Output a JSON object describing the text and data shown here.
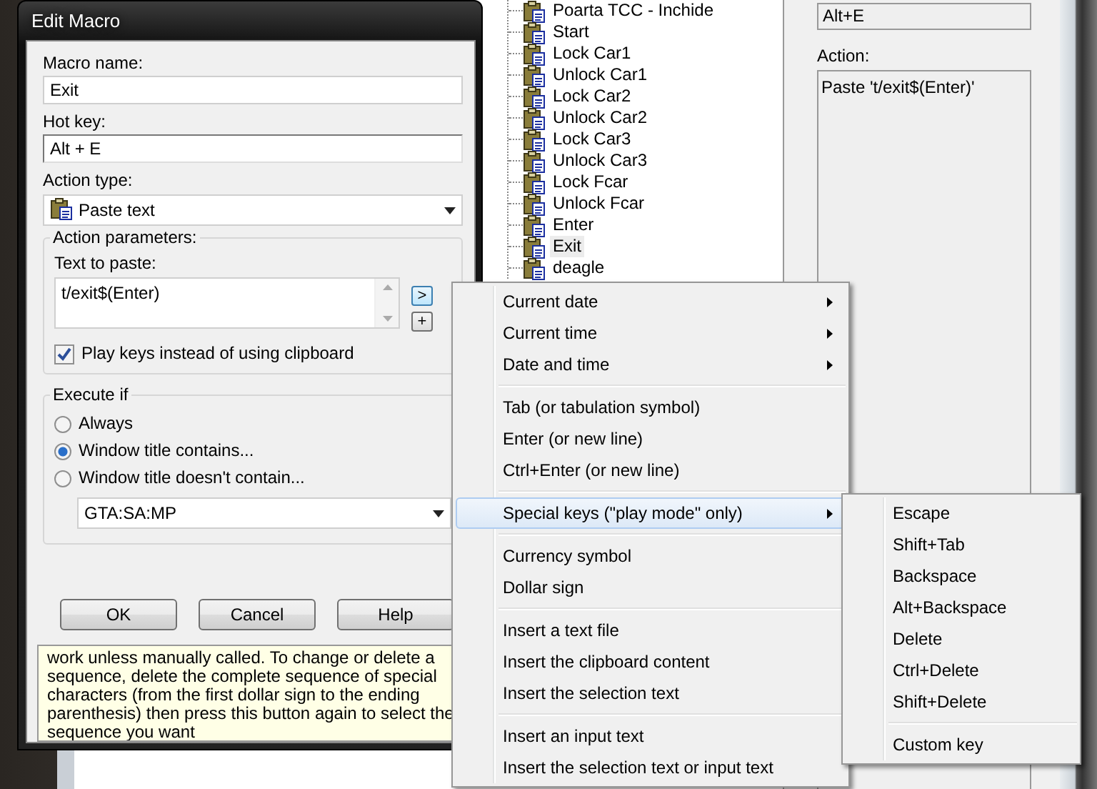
{
  "background_window": {
    "tree_items": [
      {
        "label": "Poarta TCC - Inchide",
        "selected": false
      },
      {
        "label": "Start",
        "selected": false
      },
      {
        "label": "Lock Car1",
        "selected": false
      },
      {
        "label": "Unlock Car1",
        "selected": false
      },
      {
        "label": "Lock Car2",
        "selected": false
      },
      {
        "label": "Unlock Car2",
        "selected": false
      },
      {
        "label": "Lock Car3",
        "selected": false
      },
      {
        "label": "Unlock Car3",
        "selected": false
      },
      {
        "label": "Lock Fcar",
        "selected": false
      },
      {
        "label": "Unlock Fcar",
        "selected": false
      },
      {
        "label": "Enter",
        "selected": false
      },
      {
        "label": "Exit",
        "selected": true
      },
      {
        "label": "deagle",
        "selected": false
      }
    ],
    "hotkey_value": "Alt+E",
    "action_label": "Action:",
    "action_value": "Paste 't/exit$(Enter)'"
  },
  "dialog": {
    "title": "Edit Macro",
    "macro_name_label": "Macro name:",
    "macro_name_value": "Exit",
    "hotkey_label": "Hot key:",
    "hotkey_value": "Alt + E",
    "action_type_label": "Action type:",
    "action_type_value": "Paste text",
    "parameters_group": "Action parameters:",
    "text_to_paste_label": "Text to paste:",
    "text_to_paste_value": "t/exit$(Enter)",
    "insert_button": ">",
    "add_button": "+",
    "play_keys": {
      "label": "Play keys instead of using clipboard",
      "checked": true
    },
    "execute_group": "Execute if",
    "conditions": [
      {
        "label": "Always",
        "selected": false
      },
      {
        "label": "Window title contains...",
        "selected": true
      },
      {
        "label": "Window title doesn't contain...",
        "selected": false
      }
    ],
    "window_title_value": "GTA:SA:MP",
    "buttons": [
      "OK",
      "Cancel",
      "Help"
    ],
    "help_text": "work unless manually called. To change or delete a sequence, delete the complete sequence of special characters (from the first dollar sign to the ending parenthesis) then press this button again to select the sequence you want"
  },
  "context_menu": {
    "groups": [
      [
        {
          "label": "Current date",
          "submenu": true,
          "highlighted": false
        },
        {
          "label": "Current time",
          "submenu": true,
          "highlighted": false
        },
        {
          "label": "Date and time",
          "submenu": true,
          "highlighted": false
        }
      ],
      [
        {
          "label": "Tab (or tabulation symbol)",
          "submenu": false,
          "highlighted": false
        },
        {
          "label": "Enter (or new line)",
          "submenu": false,
          "highlighted": false
        },
        {
          "label": "Ctrl+Enter (or new line)",
          "submenu": false,
          "highlighted": false
        }
      ],
      [
        {
          "label": "Special keys (\"play mode\" only)",
          "submenu": true,
          "highlighted": true
        }
      ],
      [
        {
          "label": "Currency symbol",
          "submenu": false,
          "highlighted": false
        },
        {
          "label": "Dollar sign",
          "submenu": false,
          "highlighted": false
        }
      ],
      [
        {
          "label": "Insert a text file",
          "submenu": false,
          "highlighted": false
        },
        {
          "label": "Insert the clipboard content",
          "submenu": false,
          "highlighted": false
        },
        {
          "label": "Insert the selection text",
          "submenu": false,
          "highlighted": false
        }
      ],
      [
        {
          "label": "Insert an input text",
          "submenu": false,
          "highlighted": false
        },
        {
          "label": "Insert the selection text or input text",
          "submenu": false,
          "highlighted": false
        }
      ]
    ]
  },
  "submenu": {
    "groups": [
      [
        {
          "label": "Escape",
          "submenu": false,
          "highlighted": false
        },
        {
          "label": "Shift+Tab",
          "submenu": false,
          "highlighted": false
        },
        {
          "label": "Backspace",
          "submenu": false,
          "highlighted": false
        },
        {
          "label": "Alt+Backspace",
          "submenu": false,
          "highlighted": false
        },
        {
          "label": "Delete",
          "submenu": false,
          "highlighted": false
        },
        {
          "label": "Ctrl+Delete",
          "submenu": false,
          "highlighted": false
        },
        {
          "label": "Shift+Delete",
          "submenu": false,
          "highlighted": false
        }
      ],
      [
        {
          "label": "Custom key",
          "submenu": false,
          "highlighted": false
        }
      ]
    ]
  }
}
